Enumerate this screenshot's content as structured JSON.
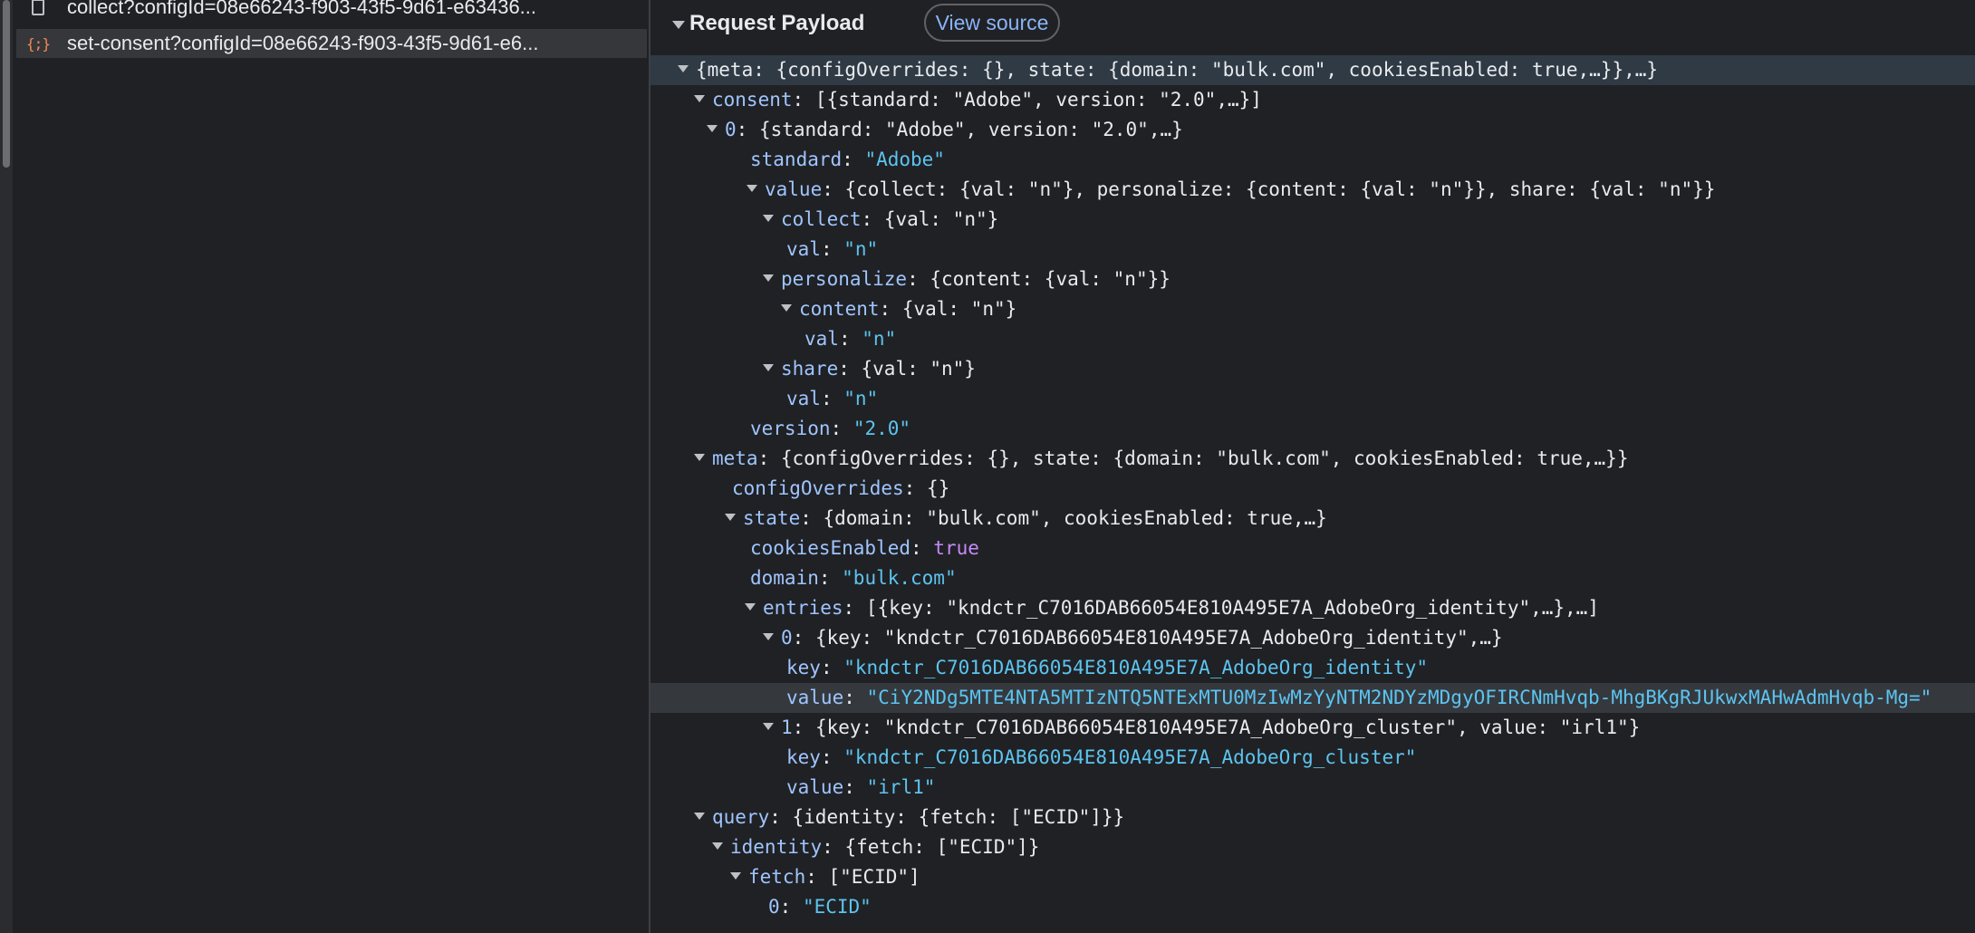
{
  "requests": [
    {
      "name": "collect?configId=08e66243-f903-43f5-9d61-e63436...",
      "icon": "document-icon"
    },
    {
      "name": "set-consent?configId=08e66243-f903-43f5-9d61-e6...",
      "icon": "json-braces-icon"
    }
  ],
  "payload": {
    "title": "Request Payload",
    "view_source_label": "View source",
    "lines": [
      {
        "summary": "{meta: {configOverrides: {}, state: {domain: \"bulk.com\", cookiesEnabled: true,…}},…}"
      },
      {
        "key": "consent",
        "summary": "[{standard: \"Adobe\", version: \"2.0\",…}]"
      },
      {
        "key": "0",
        "summary": "{standard: \"Adobe\", version: \"2.0\",…}"
      },
      {
        "key": "standard",
        "value": "\"Adobe\""
      },
      {
        "key": "value",
        "summary": "{collect: {val: \"n\"}, personalize: {content: {val: \"n\"}}, share: {val: \"n\"}}"
      },
      {
        "key": "collect",
        "summary": "{val: \"n\"}"
      },
      {
        "key": "val",
        "value": "\"n\""
      },
      {
        "key": "personalize",
        "summary": "{content: {val: \"n\"}}"
      },
      {
        "key": "content",
        "summary": "{val: \"n\"}"
      },
      {
        "key": "val",
        "value": "\"n\""
      },
      {
        "key": "share",
        "summary": "{val: \"n\"}"
      },
      {
        "key": "val",
        "value": "\"n\""
      },
      {
        "key": "version",
        "value": "\"2.0\""
      },
      {
        "key": "meta",
        "summary": "{configOverrides: {}, state: {domain: \"bulk.com\", cookiesEnabled: true,…}}"
      },
      {
        "key": "configOverrides",
        "summary": "{}"
      },
      {
        "key": "state",
        "summary": "{domain: \"bulk.com\", cookiesEnabled: true,…}"
      },
      {
        "key": "cookiesEnabled",
        "value": "true"
      },
      {
        "key": "domain",
        "value": "\"bulk.com\""
      },
      {
        "key": "entries",
        "summary": "[{key: \"kndctr_C7016DAB66054E810A495E7A_AdobeOrg_identity\",…},…]"
      },
      {
        "key": "0",
        "summary": "{key: \"kndctr_C7016DAB66054E810A495E7A_AdobeOrg_identity\",…}"
      },
      {
        "key": "key",
        "value": "\"kndctr_C7016DAB66054E810A495E7A_AdobeOrg_identity\""
      },
      {
        "key": "value",
        "value": "\"CiY2NDg5MTE4NTA5MTIzNTQ5NTExMTU0MzIwMzYyNTM2NDYzMDgyOFIRCNmHvqb-MhgBKgRJUkwxMAHwAdmHvqb-Mg=\""
      },
      {
        "key": "1",
        "summary": "{key: \"kndctr_C7016DAB66054E810A495E7A_AdobeOrg_cluster\", value: \"irl1\"}"
      },
      {
        "key": "key",
        "value": "\"kndctr_C7016DAB66054E810A495E7A_AdobeOrg_cluster\""
      },
      {
        "key": "value",
        "value": "\"irl1\""
      },
      {
        "key": "query",
        "summary": "{identity: {fetch: [\"ECID\"]}}"
      },
      {
        "key": "identity",
        "summary": "{fetch: [\"ECID\"]}"
      },
      {
        "key": "fetch",
        "summary": "[\"ECID\"]"
      },
      {
        "key": "0",
        "value": "\"ECID\""
      }
    ]
  }
}
